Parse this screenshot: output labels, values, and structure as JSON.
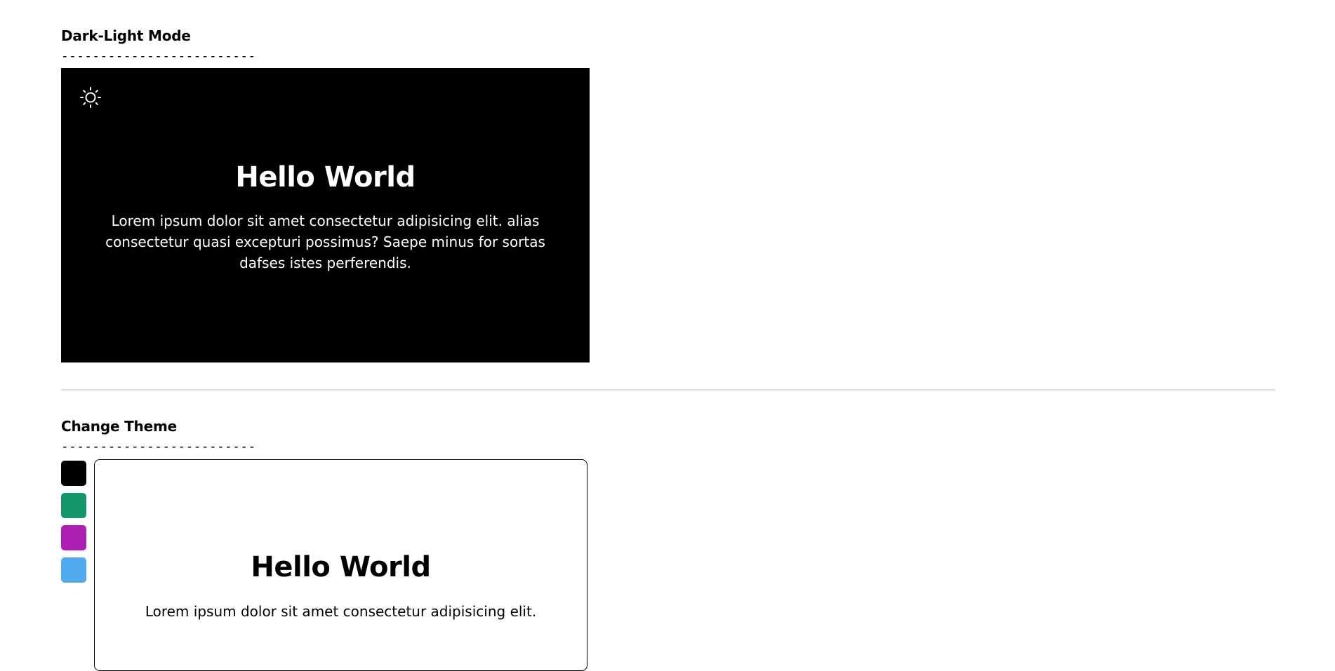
{
  "dark_light_section": {
    "title": "Dark-Light Mode",
    "separator": "-------------------------",
    "toggle_icon": "sun-icon",
    "card": {
      "heading": "Hello World",
      "text": "Lorem ipsum dolor sit amet consectetur adipisicing elit. alias consectetur quasi excepturi possimus? Saepe minus for sortas dafses istes perferendis.",
      "background": "#000000",
      "foreground": "#ffffff"
    }
  },
  "theme_section": {
    "title": "Change Theme",
    "separator": "-------------------------",
    "swatches": [
      {
        "name": "black",
        "color": "#000000"
      },
      {
        "name": "green",
        "color": "#14956b"
      },
      {
        "name": "purple",
        "color": "#ae1eb2"
      },
      {
        "name": "blue",
        "color": "#50a9ec"
      }
    ],
    "card": {
      "heading": "Hello World",
      "text": "Lorem ipsum dolor sit amet consectetur adipisicing elit."
    }
  }
}
